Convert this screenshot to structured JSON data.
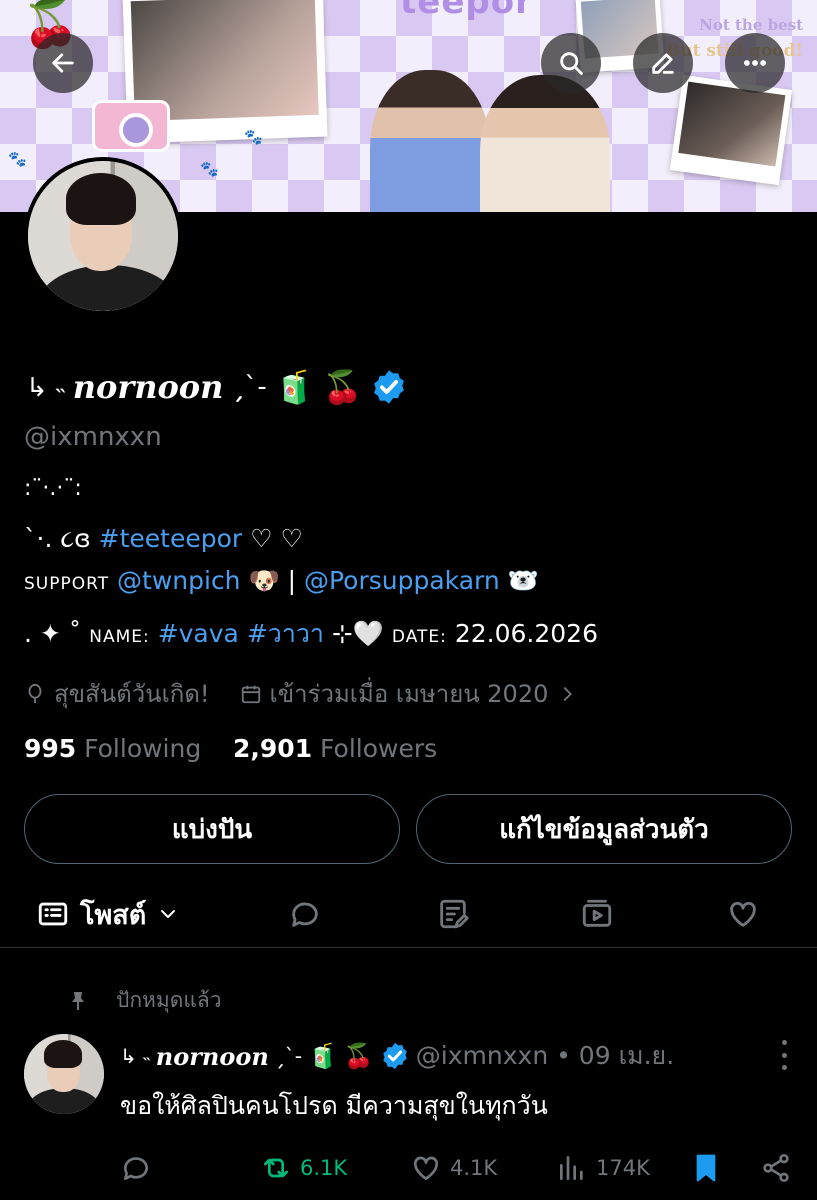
{
  "banner": {
    "logo_text": "teepor",
    "caption_line1": "Not the best",
    "caption_line2": "But still good!"
  },
  "nav": {
    "back_icon": "arrow-left-icon",
    "search_icon": "search-icon",
    "edit_icon": "pencil-icon",
    "more_icon": "more-horizontal-icon"
  },
  "profile": {
    "name_prefix": "↳ ˵",
    "name": "nornoon",
    "name_suffix": "ˏ̗ˋ-",
    "emoji_juice": "🧃",
    "emoji_cherry": "🍒",
    "verified_color": "#1d9bf0",
    "handle": "@ixmnxxn",
    "bio_line1": ":¨·.·¨:",
    "bio_line1b": "`·. ૮ɞ",
    "bio_tag": "#teeteepor",
    "bio_hearts": "♡ ♡",
    "support_label": "SUPPORT",
    "support_user1": "@twnpich",
    "support_emoji1": "🐶",
    "support_sep": "|",
    "support_user2": "@Porsuppakarn",
    "support_emoji2": "🐻‍❄️",
    "line4_prefix": ". ✦ ˚",
    "name_label": "NAME:",
    "name_tag1": "#vava",
    "name_tag2": "#วาวา",
    "sparkle": "⊹🤍",
    "date_label": "DATE:",
    "date_value": "22.06.2026",
    "birthday_text": "สุขสันต์วันเกิด!",
    "joined_text": "เข้าร่วมเมื่อ เมษายน 2020",
    "following_count": "995",
    "following_label": "Following",
    "followers_count": "2,901",
    "followers_label": "Followers"
  },
  "buttons": {
    "share_label": "แบ่งปัน",
    "edit_label": "แก้ไขข้อมูลส่วนตัว"
  },
  "tabs": {
    "posts_label": "โพสต์",
    "icons": [
      "posts-icon",
      "replies-icon",
      "articles-icon",
      "media-icon",
      "likes-icon"
    ]
  },
  "pinned": {
    "label": "ปักหมุดแล้ว",
    "tweet": {
      "name_prefix": "↳ ˵",
      "name": "nornoon",
      "name_suffix": "ˏ̗ˋ-",
      "emoji_juice": "🧃",
      "emoji_cherry": "🍒",
      "handle_time": "@ixmnxxn • 09 เม.ย.",
      "text": "ขอให้ศิลปินคนโปรด มีความสุขในทุกวัน",
      "reply_count": "",
      "retweet_count": "6.1K",
      "like_count": "4.1K",
      "views_count": "174K"
    }
  }
}
